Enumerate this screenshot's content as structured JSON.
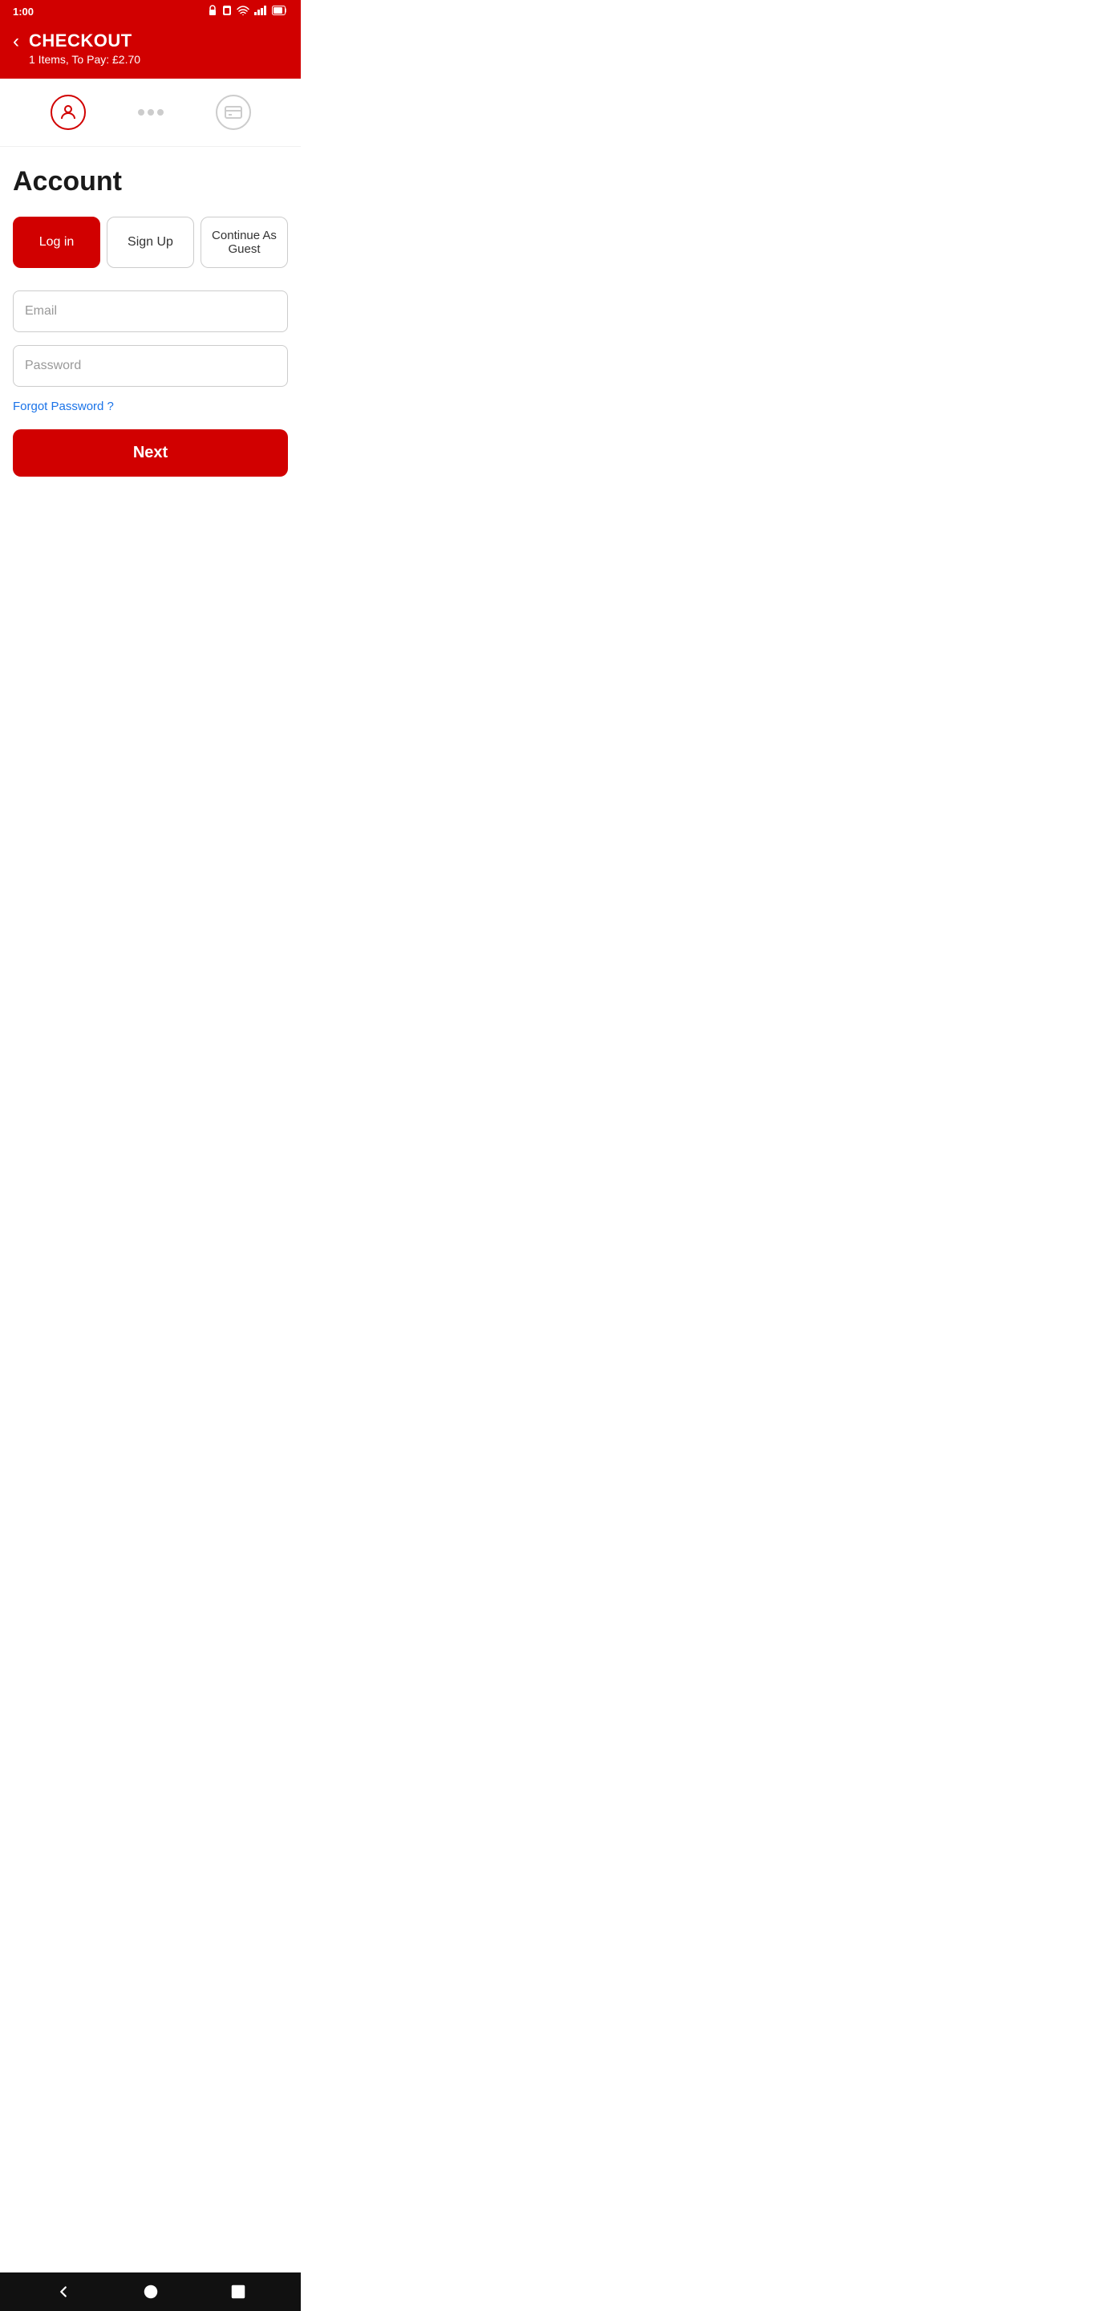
{
  "status_bar": {
    "time": "1:00",
    "icons": [
      "lock",
      "sim",
      "wifi",
      "signal",
      "battery"
    ]
  },
  "header": {
    "title": "CHECKOUT",
    "subtitle": "1 Items, To Pay: £2.70",
    "back_label": "‹"
  },
  "steps": {
    "account_icon": "person",
    "payment_icon": "card",
    "dots": [
      "•",
      "•",
      "•"
    ]
  },
  "page": {
    "title": "Account"
  },
  "tabs": {
    "login": "Log in",
    "signup": "Sign Up",
    "guest": "Continue As Guest"
  },
  "form": {
    "email_placeholder": "Email",
    "password_placeholder": "Password"
  },
  "forgot_password": "Forgot Password ?",
  "next_button": "Next",
  "bottom_nav": {
    "back_label": "◀",
    "home_label": "●",
    "recent_label": "■"
  }
}
